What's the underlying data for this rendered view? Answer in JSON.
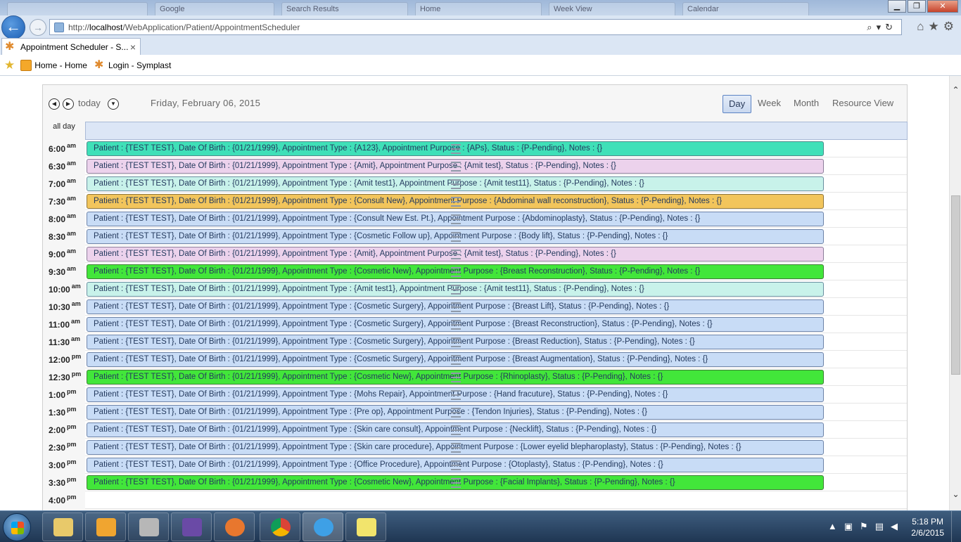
{
  "browser": {
    "url_prefix": "http://",
    "url_host": "localhost",
    "url_path": "/WebApplication/Patient/AppointmentScheduler",
    "background_tabs": [
      "Google",
      "Search Results",
      "Home",
      "Week View",
      "Calendar"
    ],
    "active_tab": "Appointment Scheduler - S...",
    "tab_close": "×",
    "favorites": [
      {
        "label": "Home - Home",
        "icon": "home-icon"
      },
      {
        "label": "Login - Symplast",
        "icon": "symplast-icon"
      }
    ]
  },
  "calendar": {
    "today_label": "today",
    "date_title": "Friday, February 06, 2015",
    "views": [
      "Day",
      "Week",
      "Month",
      "Resource View"
    ],
    "active_view": "Day",
    "allday_label": "all day",
    "slots": [
      {
        "time": "6:00",
        "ampm": "am",
        "event": "Patient : {TEST TEST}, Date Of Birth : {01/21/1999}, Appointment Type : {A123}, Appointment Purpose : {APs}, Status : {P-Pending}, Notes : {}",
        "color": "teal"
      },
      {
        "time": "6:30",
        "ampm": "am",
        "event": "Patient : {TEST TEST}, Date Of Birth : {01/21/1999}, Appointment Type : {Amit}, Appointment Purpose : {Amit test}, Status : {P-Pending}, Notes : {}",
        "color": "pink"
      },
      {
        "time": "7:00",
        "ampm": "am",
        "event": "Patient : {TEST TEST}, Date Of Birth : {01/21/1999}, Appointment Type : {Amit test1}, Appointment Purpose : {Amit test11}, Status : {P-Pending}, Notes : {}",
        "color": "mint"
      },
      {
        "time": "7:30",
        "ampm": "am",
        "event": "Patient : {TEST TEST}, Date Of Birth : {01/21/1999}, Appointment Type : {Consult New}, Appointment Purpose : {Abdominal wall reconstruction}, Status : {P-Pending}, Notes : {}",
        "color": "orange"
      },
      {
        "time": "8:00",
        "ampm": "am",
        "event": "Patient : {TEST TEST}, Date Of Birth : {01/21/1999}, Appointment Type : {Consult New Est. Pt.}, Appointment Purpose : {Abdominoplasty}, Status : {P-Pending}, Notes : {}",
        "color": "blue"
      },
      {
        "time": "8:30",
        "ampm": "am",
        "event": "Patient : {TEST TEST}, Date Of Birth : {01/21/1999}, Appointment Type : {Cosmetic Follow up}, Appointment Purpose : {Body lift}, Status : {P-Pending}, Notes : {}",
        "color": "blue"
      },
      {
        "time": "9:00",
        "ampm": "am",
        "event": "Patient : {TEST TEST}, Date Of Birth : {01/21/1999}, Appointment Type : {Amit}, Appointment Purpose : {Amit test}, Status : {P-Pending}, Notes : {}",
        "color": "pink"
      },
      {
        "time": "9:30",
        "ampm": "am",
        "event": "Patient : {TEST TEST}, Date Of Birth : {01/21/1999}, Appointment Type : {Cosmetic New}, Appointment Purpose : {Breast Reconstruction}, Status : {P-Pending}, Notes : {}",
        "color": "green"
      },
      {
        "time": "10:00",
        "ampm": "am",
        "event": "Patient : {TEST TEST}, Date Of Birth : {01/21/1999}, Appointment Type : {Amit test1}, Appointment Purpose : {Amit test11}, Status : {P-Pending}, Notes : {}",
        "color": "mint"
      },
      {
        "time": "10:30",
        "ampm": "am",
        "event": "Patient : {TEST TEST}, Date Of Birth : {01/21/1999}, Appointment Type : {Cosmetic Surgery}, Appointment Purpose : {Breast Lift}, Status : {P-Pending}, Notes : {}",
        "color": "blue"
      },
      {
        "time": "11:00",
        "ampm": "am",
        "event": "Patient : {TEST TEST}, Date Of Birth : {01/21/1999}, Appointment Type : {Cosmetic Surgery}, Appointment Purpose : {Breast Reconstruction}, Status : {P-Pending}, Notes : {}",
        "color": "blue"
      },
      {
        "time": "11:30",
        "ampm": "am",
        "event": "Patient : {TEST TEST}, Date Of Birth : {01/21/1999}, Appointment Type : {Cosmetic Surgery}, Appointment Purpose : {Breast Reduction}, Status : {P-Pending}, Notes : {}",
        "color": "blue"
      },
      {
        "time": "12:00",
        "ampm": "pm",
        "event": "Patient : {TEST TEST}, Date Of Birth : {01/21/1999}, Appointment Type : {Cosmetic Surgery}, Appointment Purpose : {Breast Augmentation}, Status : {P-Pending}, Notes : {}",
        "color": "blue"
      },
      {
        "time": "12:30",
        "ampm": "pm",
        "event": "Patient : {TEST TEST}, Date Of Birth : {01/21/1999}, Appointment Type : {Cosmetic New}, Appointment Purpose : {Rhinoplasty}, Status : {P-Pending}, Notes : {}",
        "color": "green"
      },
      {
        "time": "1:00",
        "ampm": "pm",
        "event": "Patient : {TEST TEST}, Date Of Birth : {01/21/1999}, Appointment Type : {Mohs Repair}, Appointment Purpose : {Hand fracuture}, Status : {P-Pending}, Notes : {}",
        "color": "blue"
      },
      {
        "time": "1:30",
        "ampm": "pm",
        "event": "Patient : {TEST TEST}, Date Of Birth : {01/21/1999}, Appointment Type : {Pre op}, Appointment Purpose : {Tendon Injuries}, Status : {P-Pending}, Notes : {}",
        "color": "blue"
      },
      {
        "time": "2:00",
        "ampm": "pm",
        "event": "Patient : {TEST TEST}, Date Of Birth : {01/21/1999}, Appointment Type : {Skin care consult}, Appointment Purpose : {Necklift}, Status : {P-Pending}, Notes : {}",
        "color": "blue"
      },
      {
        "time": "2:30",
        "ampm": "pm",
        "event": "Patient : {TEST TEST}, Date Of Birth : {01/21/1999}, Appointment Type : {Skin care procedure}, Appointment Purpose : {Lower eyelid blepharoplasty}, Status : {P-Pending}, Notes : {}",
        "color": "blue"
      },
      {
        "time": "3:00",
        "ampm": "pm",
        "event": "Patient : {TEST TEST}, Date Of Birth : {01/21/1999}, Appointment Type : {Office Procedure}, Appointment Purpose : {Otoplasty}, Status : {P-Pending}, Notes : {}",
        "color": "blue"
      },
      {
        "time": "3:30",
        "ampm": "pm",
        "event": "Patient : {TEST TEST}, Date Of Birth : {01/21/1999}, Appointment Type : {Cosmetic New}, Appointment Purpose : {Facial Implants}, Status : {P-Pending}, Notes : {}",
        "color": "green"
      },
      {
        "time": "4:00",
        "ampm": "pm",
        "event": "",
        "color": ""
      }
    ]
  },
  "taskbar": {
    "clock_time": "5:18 PM",
    "clock_date": "2/6/2015",
    "items": [
      "explorer-icon",
      "outlook-icon",
      "tools-icon",
      "visual-studio-icon",
      "firefox-icon",
      "chrome-icon",
      "internet-explorer-icon",
      "notes-icon"
    ]
  }
}
